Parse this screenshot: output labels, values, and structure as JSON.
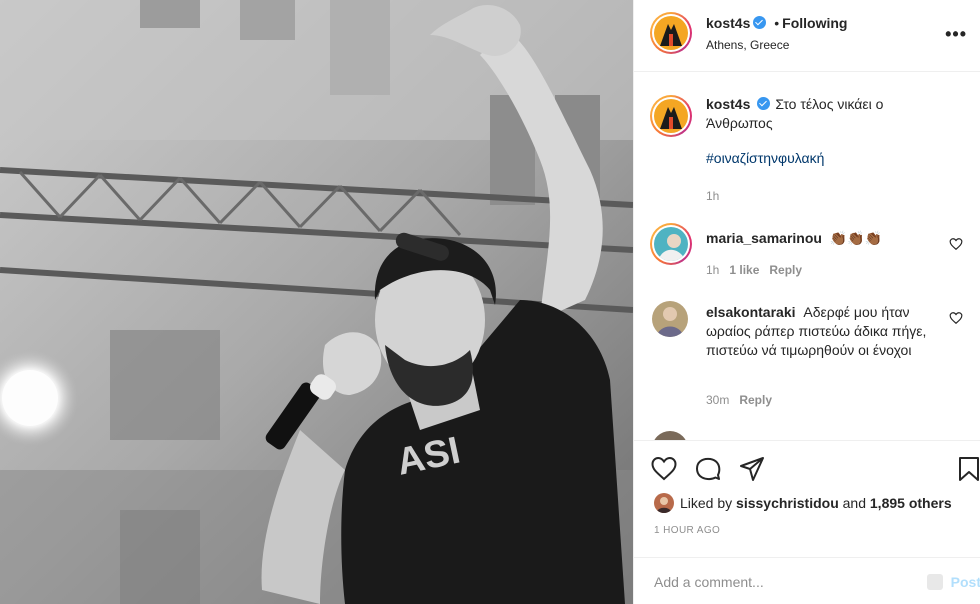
{
  "post": {
    "author": "kost4s",
    "follow_status": "Following",
    "dot": "•",
    "location": "Athens, Greece",
    "more_label": "•••",
    "caption_text": "Στο τέλος νικάει ο Άνθρωπος",
    "hashtag": "#οιναζίστηνφυλακή",
    "caption_time": "1h"
  },
  "comments": [
    {
      "user": "maria_samarinou",
      "text": "👏🏾👏🏾👏🏾",
      "time": "1h",
      "likes": "1 like",
      "reply": "Reply"
    },
    {
      "user": "elsakontaraki",
      "text": "Αδερφέ μου ήταν ωραίος ράπερ πιστεύω άδικα πήγε, πιστεύω νά τιμωρηθούν οι ένοχοι",
      "time": "30m",
      "reply": "Reply"
    }
  ],
  "likes": {
    "prefix": "Liked by",
    "user": "sissychristidou",
    "and": "and",
    "others": "1,895 others"
  },
  "timestamp": "1 HOUR AGO",
  "add_comment": {
    "placeholder": "Add a comment...",
    "post_label": "Post"
  },
  "icons": {
    "like": "heart-icon",
    "comment": "comment-icon",
    "share": "share-icon",
    "save": "bookmark-icon",
    "verified": "verified-badge-icon",
    "more": "more-options-icon"
  },
  "colors": {
    "link": "#00376b",
    "verified": "#3897f0",
    "post_button": "#b2dffc",
    "muted": "#8e8e8e"
  }
}
